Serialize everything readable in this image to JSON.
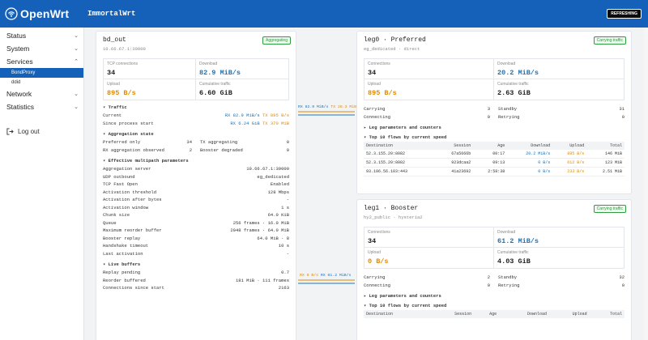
{
  "header": {
    "title": "ImmortalWrt",
    "logo_text": "OpenWrt",
    "refresh_label": "REFRESHING"
  },
  "sidebar": {
    "items": [
      {
        "label": "Status",
        "chev": "⌄"
      },
      {
        "label": "System",
        "chev": "⌄"
      },
      {
        "label": "Services",
        "chev": "⌃"
      },
      {
        "label": "Network",
        "chev": "⌄"
      },
      {
        "label": "Statistics",
        "chev": "⌄"
      }
    ],
    "sub_items": [
      "BondProxy",
      "ddid"
    ],
    "logout": "Log out"
  },
  "bond": {
    "title": "bd_out",
    "subtitle": "10.66.67.1:39000",
    "badge": "Aggregating",
    "stats": [
      {
        "label": "TCP connections",
        "value": "34"
      },
      {
        "label": "Download",
        "value": "82.9 MiB/s"
      },
      {
        "label": "Upload",
        "value": "895 B/s"
      },
      {
        "label": "Cumulative traffic",
        "value": "6.60 GiB"
      }
    ],
    "traffic_title": "Traffic",
    "traffic_rows": [
      {
        "label": "Current",
        "rx": "RX 82.9 MiB/s",
        "tx": "TX 895 B/s"
      },
      {
        "label": "Since process start",
        "rx": "RX 6.24 GiB",
        "tx": "TX 370 MiB"
      }
    ],
    "agg_title": "Aggregation state",
    "agg_rows": [
      {
        "l1": "Preferred only",
        "v1": "34",
        "l2": "TX aggregating",
        "v2": "0"
      },
      {
        "l1": "RX aggregation observed",
        "v1": "2",
        "l2": "Booster degraded",
        "v2": "0"
      }
    ],
    "params_title": "Effective multipath parameters",
    "params": [
      {
        "k": "Aggregation server",
        "v": "10.66.67.1:39000"
      },
      {
        "k": "UDP outbound",
        "v": "eg_dedicated"
      },
      {
        "k": "TCP Fast Open",
        "v": "Enabled"
      },
      {
        "k": "Activation threshold",
        "v": "128 Mbps"
      },
      {
        "k": "Activation after bytes",
        "v": "-"
      },
      {
        "k": "Activation window",
        "v": "1 s"
      },
      {
        "k": "Chunk size",
        "v": "64.0 KiB"
      },
      {
        "k": "Queue",
        "v": "256 frames · 16.0 MiB"
      },
      {
        "k": "Maximum reorder buffer",
        "v": "2048 frames · 64.0 MiB"
      },
      {
        "k": "Booster replay",
        "v": "64.0 MiB · 8"
      },
      {
        "k": "Handshake timeout",
        "v": "10 s"
      },
      {
        "k": "Last activation",
        "v": "-"
      }
    ],
    "buffers_title": "Live buffers",
    "buffers": [
      {
        "k": "Replay pending",
        "v": "0.7"
      },
      {
        "k": "Reorder buffered",
        "v": "181 MiB · 111 frames"
      },
      {
        "k": "Connections since start",
        "v": "2163"
      }
    ]
  },
  "connectors": [
    {
      "a": "RX 82.9 MiB/s",
      "b": "TX 28.3 MiB/s"
    },
    {
      "a": "RX 0 B/s",
      "b": "RX 61.2 MiB/s"
    }
  ],
  "leg0": {
    "title": "leg0 · Preferred",
    "subtitle": "eg_dedicated · direct",
    "badge": "Carrying traffic",
    "stats": [
      {
        "label": "Connections",
        "value": "34"
      },
      {
        "label": "Download",
        "value": "20.2 MiB/s"
      },
      {
        "label": "Upload",
        "value": "895 B/s"
      },
      {
        "label": "Cumulative traffic",
        "value": "2.63 GiB"
      }
    ],
    "state_rows": [
      {
        "l1": "Carrying",
        "v1": "3",
        "l2": "Standby",
        "v2": "31"
      },
      {
        "l1": "Connecting",
        "v1": "0",
        "l2": "Retrying",
        "v2": "0"
      }
    ],
    "params_toggle": "Leg parameters and counters",
    "flows_title": "Top 10 flows by current speed",
    "flows_header": [
      "Destination",
      "Session",
      "Age",
      "Download",
      "Upload",
      "Total"
    ],
    "flows": [
      [
        "52.3.155.20:8082",
        "67a5666b",
        "00:17",
        "20.2 MiB/s",
        "895 B/s",
        "146 MiB"
      ],
      [
        "52.3.155.20:8082",
        "923dcaa2",
        "09:13",
        "0 B/s",
        "612 B/s",
        "123 MiB"
      ],
      [
        "93.106.56.103:443",
        "41a23692",
        "2:58:38",
        "0 B/s",
        "233 B/s",
        "2.51 MiB"
      ]
    ]
  },
  "leg1": {
    "title": "leg1 · Booster",
    "subtitle": "hy2_public · hysteria2",
    "badge": "Carrying traffic",
    "stats": [
      {
        "label": "Connections",
        "value": "34"
      },
      {
        "label": "Download",
        "value": "61.2 MiB/s"
      },
      {
        "label": "Upload",
        "value": "0 B/s"
      },
      {
        "label": "Cumulative traffic",
        "value": "4.03 GiB"
      }
    ],
    "state_rows": [
      {
        "l1": "Carrying",
        "v1": "2",
        "l2": "Standby",
        "v2": "32"
      },
      {
        "l1": "Connecting",
        "v1": "0",
        "l2": "Retrying",
        "v2": "0"
      }
    ],
    "params_toggle": "Leg parameters and counters",
    "flows_title": "Top 10 flows by current speed",
    "flows_header": [
      "Destination",
      "Session",
      "Age",
      "Download",
      "Upload",
      "Total"
    ]
  },
  "colors": {
    "accent": "#1560b8",
    "download": "#1a73b8",
    "upload": "#e08a00",
    "ok": "#2e9d3e"
  }
}
